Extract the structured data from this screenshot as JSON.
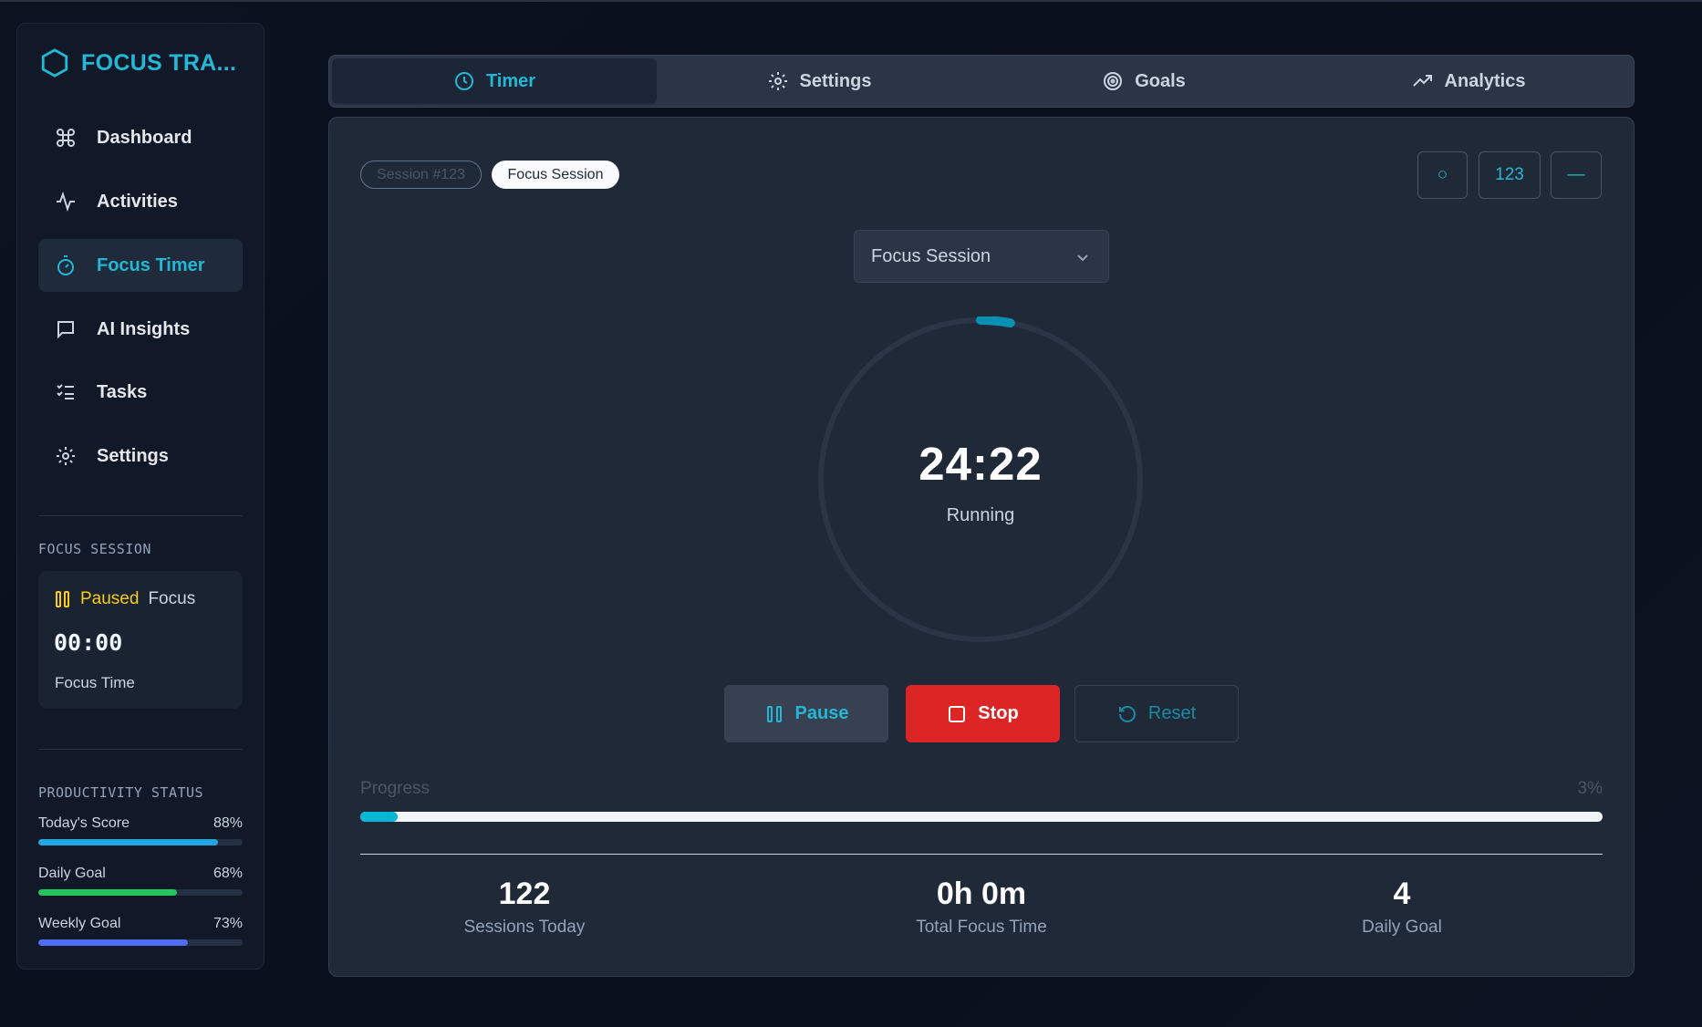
{
  "app": {
    "title": "FOCUS TRA..."
  },
  "sidebar": {
    "items": [
      {
        "label": "Dashboard",
        "icon": "command-icon"
      },
      {
        "label": "Activities",
        "icon": "activity-icon"
      },
      {
        "label": "Focus Timer",
        "icon": "timer-icon",
        "active": true
      },
      {
        "label": "AI Insights",
        "icon": "message-icon"
      },
      {
        "label": "Tasks",
        "icon": "list-checks-icon"
      },
      {
        "label": "Settings",
        "icon": "gear-icon"
      }
    ],
    "focus_session": {
      "section_label": "FOCUS SESSION",
      "status": "Paused",
      "mode": "Focus",
      "time": "00:00",
      "time_label": "Focus Time"
    },
    "productivity": {
      "section_label": "PRODUCTIVITY STATUS",
      "metrics": [
        {
          "label": "Today's Score",
          "value": "88%",
          "percent": 88,
          "color": "#22a7e0"
        },
        {
          "label": "Daily Goal",
          "value": "68%",
          "percent": 68,
          "color": "#22c55e"
        },
        {
          "label": "Weekly Goal",
          "value": "73%",
          "percent": 73,
          "color": "#4f6df5"
        }
      ]
    }
  },
  "tabs": [
    {
      "label": "Timer",
      "icon": "clock-icon",
      "active": true
    },
    {
      "label": "Settings",
      "icon": "gear-icon"
    },
    {
      "label": "Goals",
      "icon": "target-icon"
    },
    {
      "label": "Analytics",
      "icon": "trending-up-icon"
    }
  ],
  "timer": {
    "session_pill": "Session #123",
    "type_pill": "Focus Session",
    "top_buttons": [
      "○",
      "123",
      "—"
    ],
    "session_select": "Focus Session",
    "time": "24:22",
    "status": "Running",
    "ring_progress": 0.03,
    "controls": {
      "pause": "Pause",
      "stop": "Stop",
      "reset": "Reset"
    },
    "progress_label": "Progress",
    "progress_value": "3%",
    "progress_percent": 3,
    "stats": [
      {
        "value": "122",
        "label": "Sessions Today"
      },
      {
        "value": "0h 0m",
        "label": "Total Focus Time"
      },
      {
        "value": "4",
        "label": "Daily Goal"
      }
    ]
  },
  "colors": {
    "accent": "#22b8d6",
    "stop": "#dc2626",
    "paused": "#facc15"
  }
}
